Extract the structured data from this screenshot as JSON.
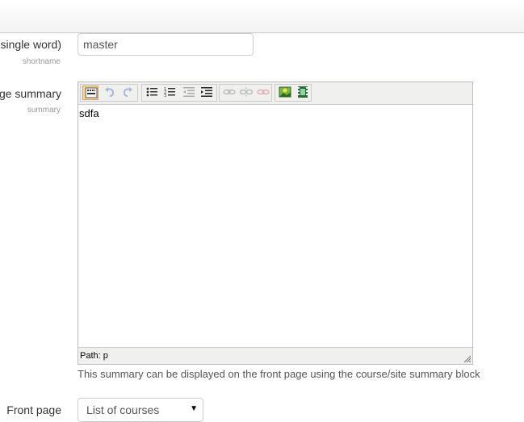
{
  "fields": {
    "shortname": {
      "label": "single word)",
      "sublabel": "shortname",
      "value": "master"
    },
    "summary": {
      "label": "ge summary",
      "sublabel": "summary",
      "content": "sdfa",
      "path_text": "Path: p",
      "help": "This summary can be displayed on the front page using the course/site summary block"
    },
    "frontpage": {
      "label": "Front page",
      "selected": "List of courses"
    }
  },
  "toolbar": {
    "buttons": [
      {
        "name": "toggle-toolbar-icon",
        "state": "active"
      },
      {
        "name": "undo-icon",
        "state": "disabled"
      },
      {
        "name": "redo-icon",
        "state": "disabled"
      },
      {
        "name": "unordered-list-icon",
        "state": "enabled"
      },
      {
        "name": "ordered-list-icon",
        "state": "enabled"
      },
      {
        "name": "outdent-icon",
        "state": "disabled"
      },
      {
        "name": "indent-icon",
        "state": "enabled"
      },
      {
        "name": "link-icon",
        "state": "disabled"
      },
      {
        "name": "unlink-icon",
        "state": "disabled"
      },
      {
        "name": "nolink-icon",
        "state": "disabled"
      },
      {
        "name": "insert-image-icon",
        "state": "enabled"
      },
      {
        "name": "insert-media-icon",
        "state": "enabled"
      }
    ]
  },
  "colors": {
    "active_button_bg": "#f5d7a5",
    "toolbar_bg": "#f0f0ee",
    "border": "#cccccc"
  }
}
